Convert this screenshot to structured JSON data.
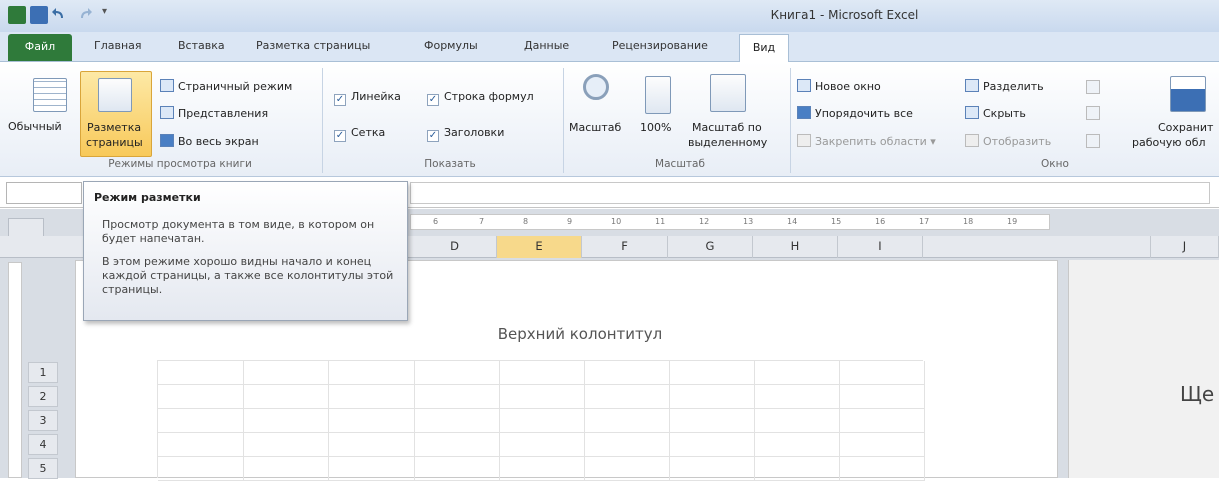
{
  "window": {
    "title": "Книга1 - Microsoft Excel"
  },
  "tabs": [
    {
      "label": "Файл"
    },
    {
      "label": "Главная"
    },
    {
      "label": "Вставка"
    },
    {
      "label": "Разметка страницы"
    },
    {
      "label": "Формулы"
    },
    {
      "label": "Данные"
    },
    {
      "label": "Рецензирование"
    },
    {
      "label": "Вид"
    }
  ],
  "ribbon": {
    "views": {
      "normal": "Обычный",
      "page_layout_1": "Разметка",
      "page_layout_2": "страницы",
      "page_break": "Страничный режим",
      "custom": "Представления",
      "fullscreen": "Во весь экран",
      "group_label": "Режимы просмотра книги"
    },
    "show": {
      "ruler": "Линейка",
      "formula_bar": "Строка формул",
      "gridlines": "Сетка",
      "headings": "Заголовки",
      "group_label": "Показать"
    },
    "zoom": {
      "zoom": "Масштаб",
      "hundred": "100%",
      "zoom_selection_1": "Масштаб по",
      "zoom_selection_2": "выделенному",
      "group_label": "Масштаб"
    },
    "window": {
      "new_window": "Новое окно",
      "arrange_all": "Упорядочить все",
      "freeze_panes": "Закрепить области",
      "split": "Разделить",
      "hide": "Скрыть",
      "unhide": "Отобразить",
      "save_ws_1": "Сохранит",
      "save_ws_2": "рабочую обл",
      "group_label": "Окно"
    }
  },
  "tooltip": {
    "title": "Режим разметки",
    "p1": "Просмотр документа в том виде, в котором он будет напечатан.",
    "p2": "В этом режиме хорошо видны начало и конец каждой страницы, а также все колонтитулы этой страницы."
  },
  "ruler": {
    "marks": [
      "6",
      "7",
      "8",
      "9",
      "10",
      "11",
      "12",
      "13",
      "14",
      "15",
      "16",
      "17",
      "18",
      "19"
    ]
  },
  "columns": [
    "D",
    "E",
    "F",
    "G",
    "H",
    "I",
    "J"
  ],
  "rows": [
    "1",
    "2",
    "3",
    "4",
    "5"
  ],
  "page": {
    "header_text": "Верхний колонтитул",
    "partial_text": "Ще"
  },
  "colors": {
    "file_tab": "#2f7a3a",
    "active_column": "#f7d98b",
    "ribbon_bg": "#f3f6fa"
  }
}
